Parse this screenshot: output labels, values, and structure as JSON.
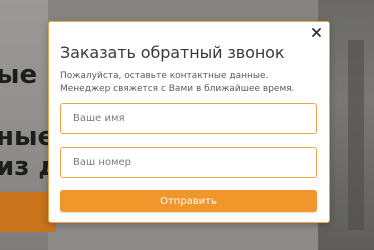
{
  "background": {
    "heading_line_1": "ые",
    "heading_line_2": "ные",
    "heading_line_3": "из д"
  },
  "modal": {
    "close_icon": "close-icon",
    "title": "Заказать обратный звонок",
    "subtitle_line_1": "Пожалуйста, оставьте контактные данные.",
    "subtitle_line_2": "Менеджер свяжется с Вами в ближайшее время.",
    "name_field": {
      "placeholder": "Ваше имя",
      "value": ""
    },
    "phone_field": {
      "placeholder": "Ваш номер",
      "value": ""
    },
    "submit_label": "Отправить"
  },
  "colors": {
    "accent": "#f0962a",
    "border": "#f0a54a",
    "overlay": "#8c8b88"
  }
}
